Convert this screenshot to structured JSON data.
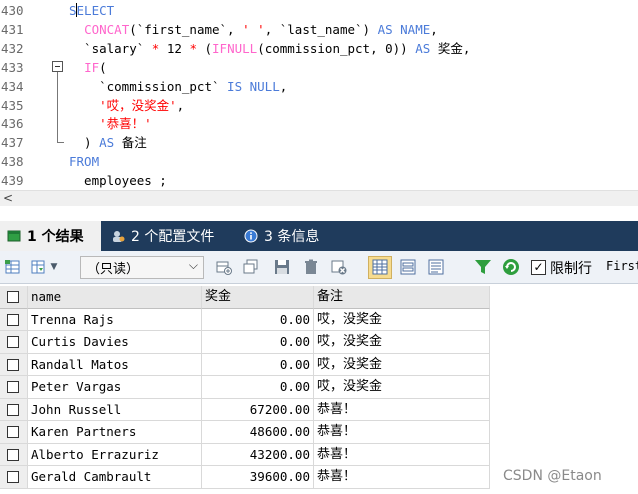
{
  "editor": {
    "lines": [
      {
        "num": "430",
        "parts": [
          {
            "t": "SELECT",
            "c": "kw"
          }
        ]
      },
      {
        "num": "431",
        "parts": [
          {
            "t": "  ",
            "c": "txt"
          },
          {
            "t": "CONCAT",
            "c": "fn"
          },
          {
            "t": "(`first_name`, ",
            "c": "txt"
          },
          {
            "t": "' '",
            "c": "str"
          },
          {
            "t": ", `last_name`) ",
            "c": "txt"
          },
          {
            "t": "AS NAME",
            "c": "kw"
          },
          {
            "t": ",",
            "c": "txt"
          }
        ]
      },
      {
        "num": "432",
        "parts": [
          {
            "t": "  `salary` ",
            "c": "txt"
          },
          {
            "t": "*",
            "c": "str"
          },
          {
            "t": " 12 ",
            "c": "txt"
          },
          {
            "t": "*",
            "c": "str"
          },
          {
            "t": " (",
            "c": "txt"
          },
          {
            "t": "IFNULL",
            "c": "fn"
          },
          {
            "t": "(commission_pct, 0)) ",
            "c": "txt"
          },
          {
            "t": "AS",
            "c": "kw"
          },
          {
            "t": " 奖金,",
            "c": "txt"
          }
        ]
      },
      {
        "num": "433",
        "parts": [
          {
            "t": "  ",
            "c": "txt"
          },
          {
            "t": "IF",
            "c": "fn"
          },
          {
            "t": "(",
            "c": "txt"
          }
        ]
      },
      {
        "num": "434",
        "parts": [
          {
            "t": "    `commission_pct` ",
            "c": "txt"
          },
          {
            "t": "IS NULL",
            "c": "kw"
          },
          {
            "t": ",",
            "c": "txt"
          }
        ]
      },
      {
        "num": "435",
        "parts": [
          {
            "t": "    ",
            "c": "txt"
          },
          {
            "t": "'哎，没奖金'",
            "c": "str"
          },
          {
            "t": ",",
            "c": "txt"
          }
        ]
      },
      {
        "num": "436",
        "parts": [
          {
            "t": "    ",
            "c": "txt"
          },
          {
            "t": "'恭喜！'",
            "c": "str"
          }
        ]
      },
      {
        "num": "437",
        "parts": [
          {
            "t": "  ) ",
            "c": "txt"
          },
          {
            "t": "AS",
            "c": "kw"
          },
          {
            "t": " 备注",
            "c": "txt"
          }
        ]
      },
      {
        "num": "438",
        "parts": [
          {
            "t": "FROM",
            "c": "kw"
          }
        ]
      },
      {
        "num": "439",
        "parts": [
          {
            "t": "  employees ;",
            "c": "txt"
          }
        ]
      }
    ],
    "scroll_arrow": "<"
  },
  "tabs": [
    {
      "label": "1 个结果",
      "icon": "result-grid-icon",
      "active": true
    },
    {
      "label": "2 个配置文件",
      "icon": "profile-icon",
      "active": false
    },
    {
      "label": "3 条信息",
      "icon": "info-icon",
      "active": false
    }
  ],
  "toolbar": {
    "mode_select": "（只读）",
    "limit_label": "限制行",
    "first_label": "First",
    "limit_checked": true
  },
  "grid": {
    "columns": [
      "name",
      "奖金",
      "备注"
    ],
    "rows": [
      [
        "Trenna Rajs",
        "0.00",
        "哎，没奖金"
      ],
      [
        "Curtis Davies",
        "0.00",
        "哎，没奖金"
      ],
      [
        "Randall Matos",
        "0.00",
        "哎，没奖金"
      ],
      [
        "Peter Vargas",
        "0.00",
        "哎，没奖金"
      ],
      [
        "John Russell",
        "67200.00",
        "恭喜！"
      ],
      [
        "Karen Partners",
        "48600.00",
        "恭喜！"
      ],
      [
        "Alberto Errazuriz",
        "43200.00",
        "恭喜！"
      ],
      [
        "Gerald Cambrault",
        "39600.00",
        "恭喜！"
      ]
    ]
  },
  "watermark": "CSDN @Etaon",
  "colors": {
    "keyword": "#4b7bd9",
    "function": "#ff66cc",
    "string": "#ff0000",
    "tab_bar": "#1f3b5c"
  }
}
